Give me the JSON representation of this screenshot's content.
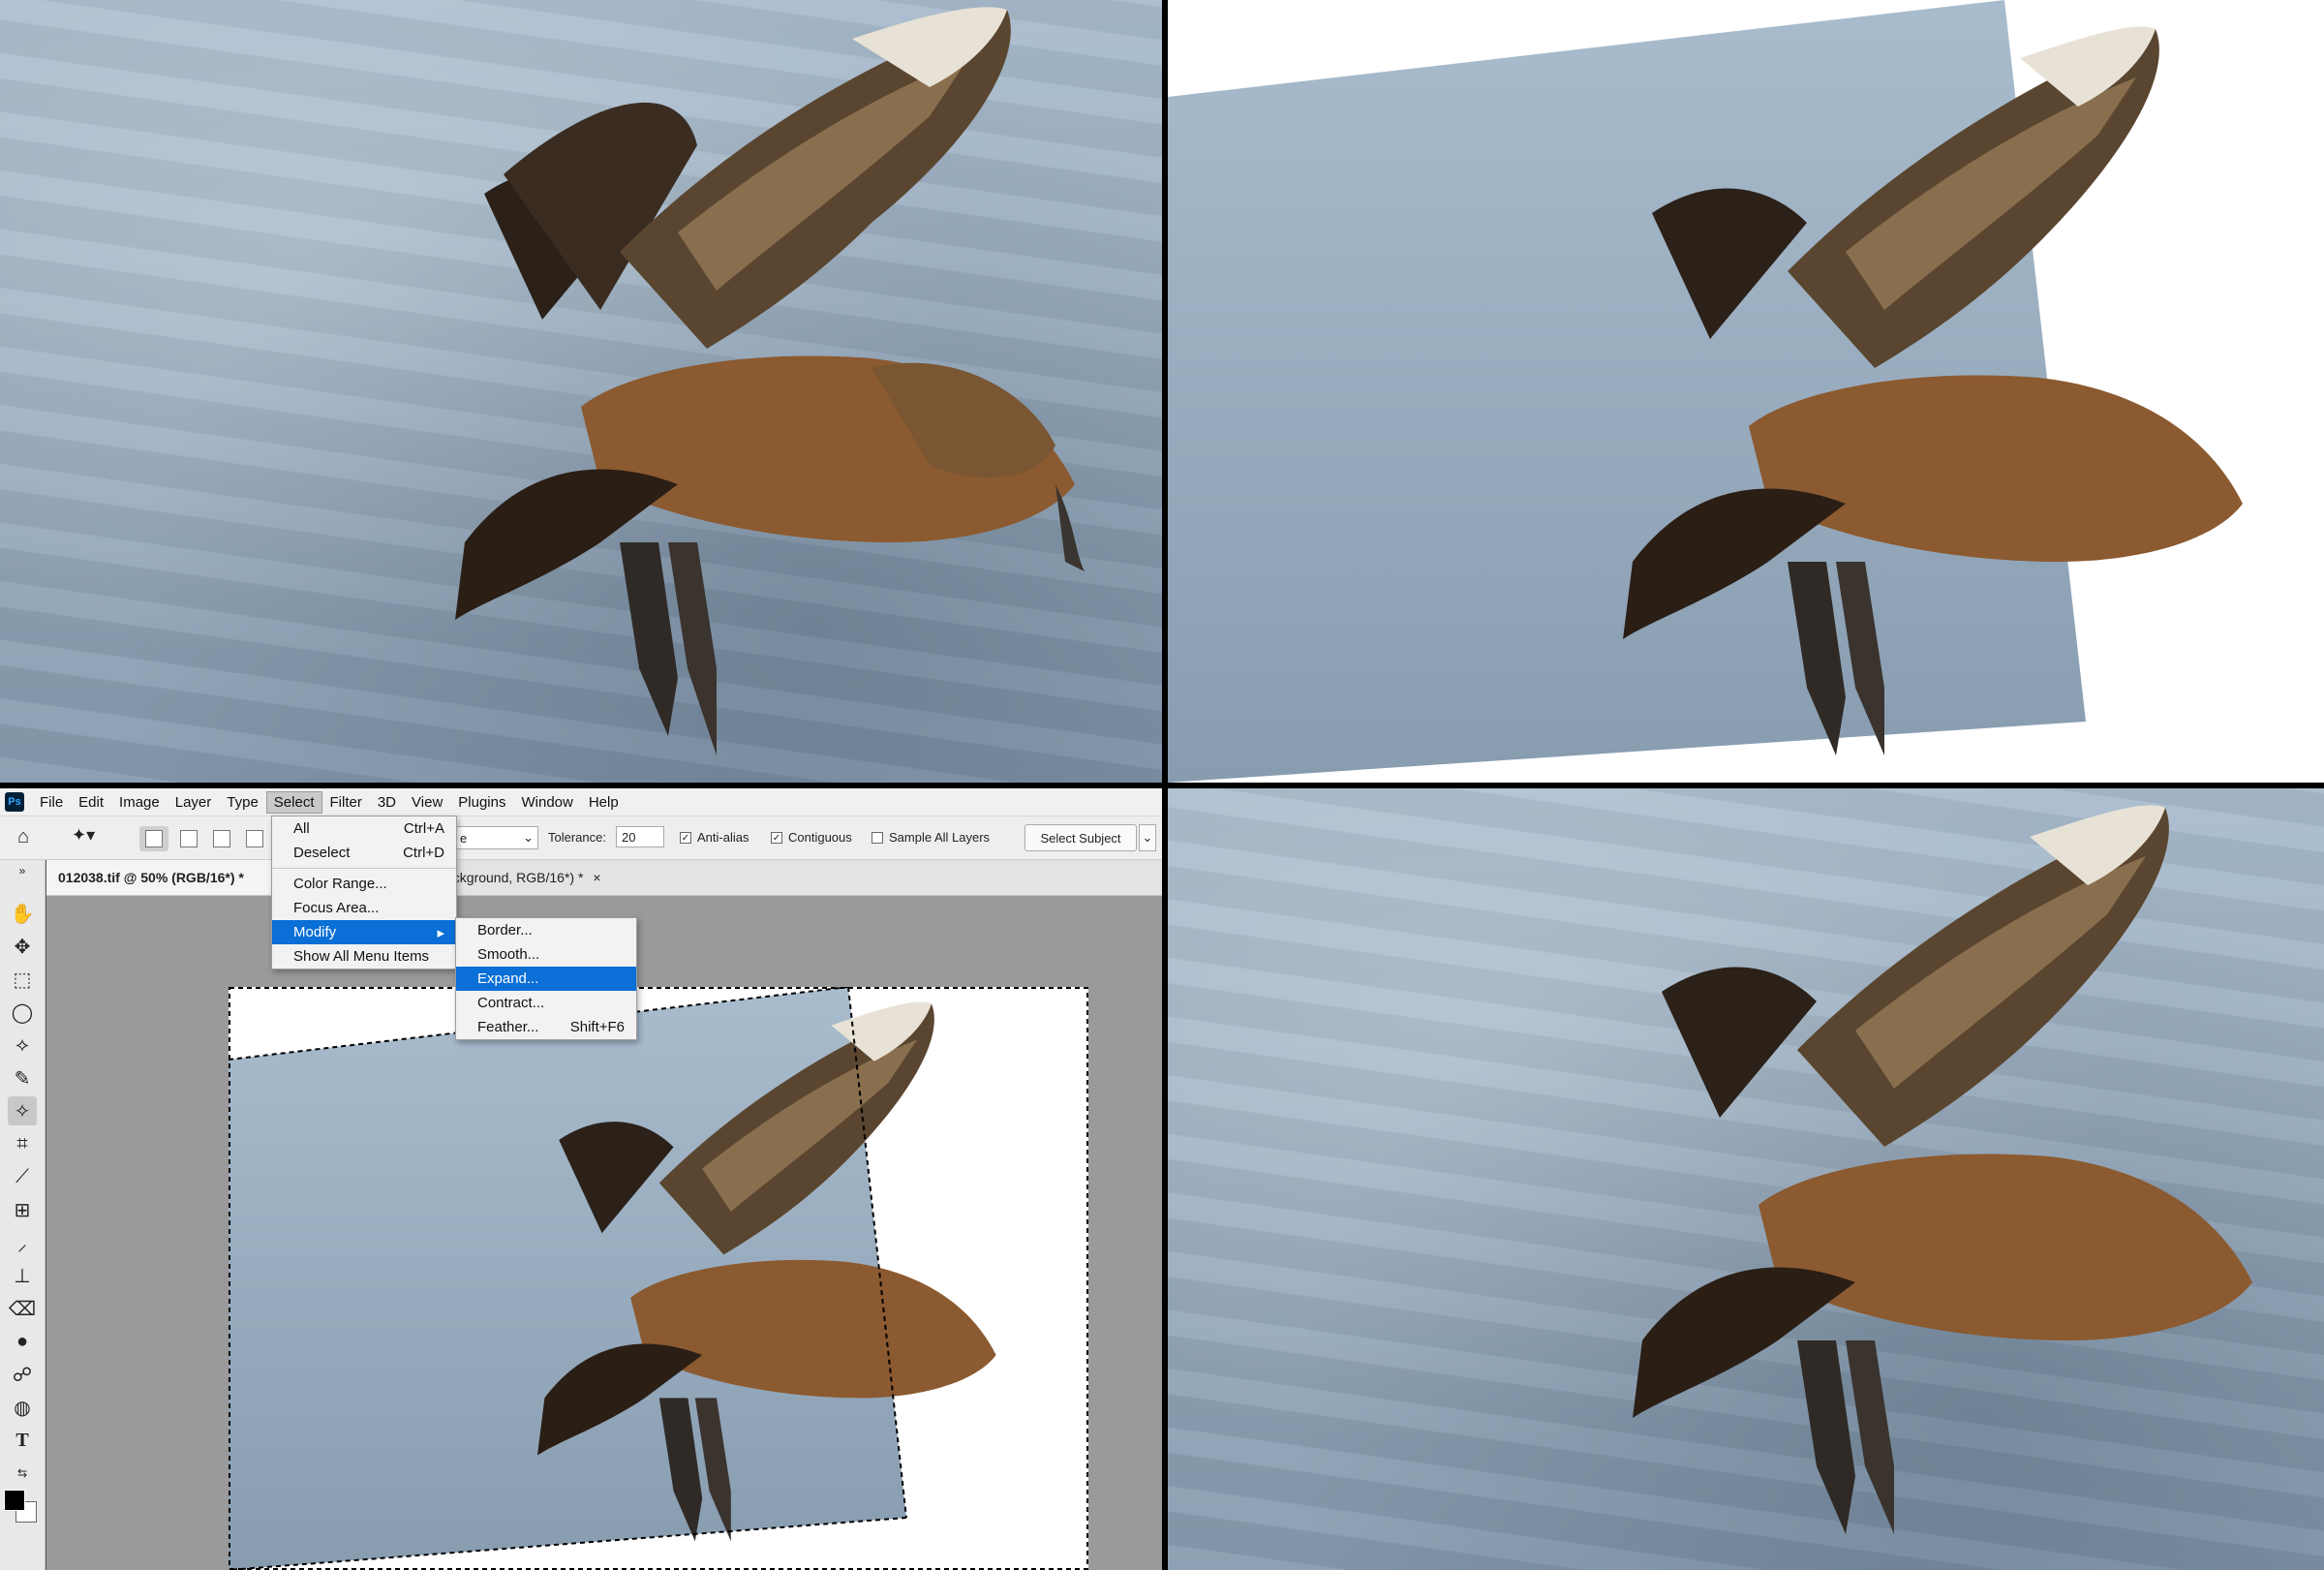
{
  "menubar": {
    "logo": "Ps",
    "items": [
      "File",
      "Edit",
      "Image",
      "Layer",
      "Type",
      "Select",
      "Filter",
      "3D",
      "View",
      "Plugins",
      "Window",
      "Help"
    ],
    "active": "Select"
  },
  "options_bar": {
    "mode_value": "e",
    "tolerance_label": "Tolerance:",
    "tolerance_value": "20",
    "anti_alias": "Anti-alias",
    "contiguous": "Contiguous",
    "sample_all_layers": "Sample All Layers",
    "select_subject": "Select Subject"
  },
  "tabs": [
    {
      "label": "012038.tif @ 50% (RGB/16*) *"
    },
    {
      "label": "ackground, RGB/16*) *",
      "close": "×"
    }
  ],
  "select_menu": {
    "items": [
      {
        "label": "All",
        "shortcut": "Ctrl+A"
      },
      {
        "label": "Deselect",
        "shortcut": "Ctrl+D"
      },
      {
        "label": "Color Range..."
      },
      {
        "label": "Focus Area..."
      },
      {
        "label": "Modify",
        "submenu": "▸"
      },
      {
        "label": "Show All Menu Items"
      }
    ]
  },
  "modify_submenu": {
    "items": [
      {
        "label": "Border..."
      },
      {
        "label": "Smooth..."
      },
      {
        "label": "Expand..."
      },
      {
        "label": "Contract..."
      },
      {
        "label": "Feather...",
        "shortcut": "Shift+F6"
      }
    ],
    "highlighted": "Expand..."
  },
  "tools": [
    "hand",
    "move",
    "marquee",
    "lasso",
    "polygonal-lasso",
    "quick-selection",
    "magic-wand",
    "crop",
    "eyedropper",
    "healing",
    "brush",
    "stamp",
    "eraser",
    "burn",
    "sponge",
    "smudge",
    "type",
    "swap-colors",
    "colors"
  ],
  "colors": {
    "selection_highlight": "#0a6fd6",
    "menu_bg": "#f2f2f2"
  }
}
